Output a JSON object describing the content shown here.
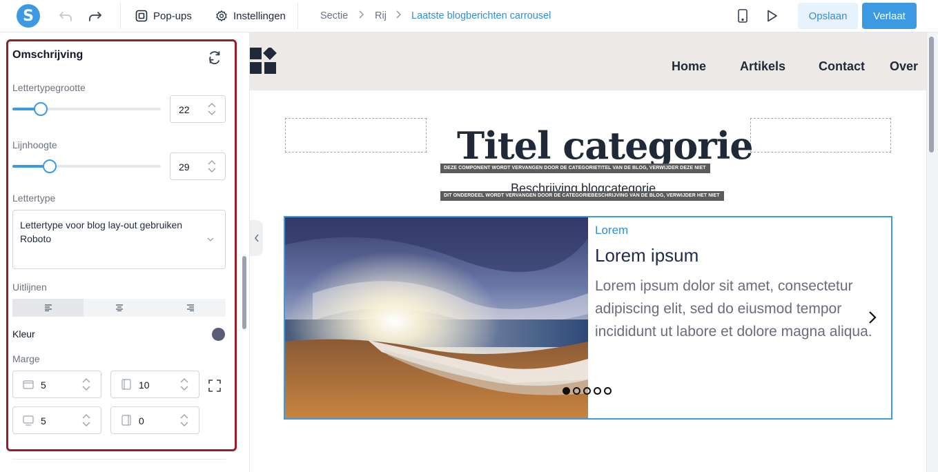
{
  "toolbar": {
    "logo_letter": "S",
    "popups_label": "Pop-ups",
    "settings_label": "Instellingen",
    "breadcrumb": [
      "Sectie",
      "Rij",
      "Laatste blogberichten carrousel"
    ],
    "save_label": "Opslaan",
    "leave_label": "Verlaat"
  },
  "panel": {
    "title": "Omschrijving",
    "font_size": {
      "label": "Lettertypegrootte",
      "value": "22",
      "slider_fraction": 0.19
    },
    "line_height": {
      "label": "Lijnhoogte",
      "value": "29",
      "slider_fraction": 0.25
    },
    "font": {
      "label": "Lettertype",
      "line1": "Lettertype voor blog lay-out gebruiken",
      "line2": "Roboto"
    },
    "align": {
      "label": "Uitlijnen",
      "options": [
        "left",
        "center",
        "right"
      ],
      "selected": "left"
    },
    "color": {
      "label": "Kleur",
      "value": "#5a5c78"
    },
    "margin": {
      "label": "Marge",
      "top": "5",
      "right": "10",
      "bottom": "5",
      "left": "0"
    }
  },
  "site": {
    "nav": [
      "Home",
      "Artikels",
      "Contact",
      "Over"
    ],
    "title": "Titel categorie",
    "title_notice": "DEZE COMPONENT WORDT VERVANGEN DOOR DE CATEGORIETITEL VAN DE BLOG, VERWIJDER DEZE NIET",
    "description": "Beschrijving blogcategorie",
    "description_notice": "DIT ONDERDEEL WORDT VERVANGEN DOOR DE CATEGORIEBESCHRIJVING VAN DE BLOG, VERWIJDER HET NIET"
  },
  "carousel": {
    "kicker": "Lorem",
    "title": "Lorem ipsum",
    "text": "Lorem ipsum dolor sit amet, consectetur adipiscing elit, sed do eiusmod tempor incididunt ut labore et dolore magna aliqua.",
    "slide_count": 5,
    "active_slide": 1
  },
  "colors": {
    "accent": "#3b9ae1",
    "panel_border": "#9b1d27"
  }
}
